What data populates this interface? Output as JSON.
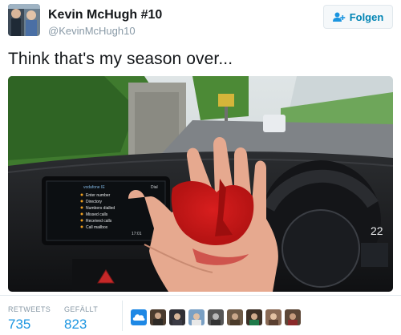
{
  "header": {
    "display_name": "Kevin McHugh #10",
    "handle": "@KevinMcHugh10",
    "follow_label": "Folgen",
    "accent_color": "#1b95e0"
  },
  "tweet": {
    "text": "Think that's my season over..."
  },
  "media": {
    "screen_title": "vodafone IE",
    "screen_tab": "Dial",
    "menu_items": [
      "Enter number",
      "Directory",
      "Numbers dialled",
      "Missed calls",
      "Received calls",
      "Call mailbox"
    ],
    "screen_time": "17:01",
    "dash_readout": "22"
  },
  "stats": {
    "retweets_label": "RETWEETS",
    "retweets_value": "735",
    "likes_label": "GEFÄLLT",
    "likes_value": "823",
    "liker_avatars": [
      "cloud-icon",
      "avatar",
      "avatar",
      "avatar",
      "avatar",
      "avatar",
      "avatar",
      "avatar",
      "avatar"
    ]
  }
}
